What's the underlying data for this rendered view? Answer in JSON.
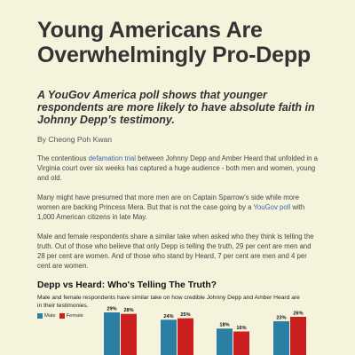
{
  "article": {
    "headline": "Young Americans Are Overwhelmingly Pro-Depp",
    "subheadline": "A YouGov America poll shows that younger respondents are more likely to have absolute faith in Johnny Depp’s testimony.",
    "byline": "By Cheong Poh Kwan",
    "p1": {
      "pre": "The contentious ",
      "link": "defamation trial",
      "post": " between Johnny Depp and Amber Heard that unfolded in a Virginia court over six weeks has captured a huge audience - both men and women, young and old."
    },
    "p2": {
      "pre": "Many might have presumed that more men are on Captain Sparrow’s side while more women are backing Princess Mera. But that is not the case going by a ",
      "link": "YouGov poll",
      "post": " with 1,000 American citizens in late May."
    },
    "p3": "Male and female respondents share a similar take when asked who they think is telling the truth. Out of those who believe that only Depp is telling the truth, 29 per cent are men and 28 per cent are women. And of those who stand by Heard, 7 per cent are men and 4 per cent are women."
  },
  "colors": {
    "background": "#f6f3dc",
    "male": "#2a7fa3",
    "female": "#cc1f1f",
    "link": "#3c67b0"
  },
  "chart_data": {
    "type": "bar",
    "title": "Depp vs Heard: Who's Telling The Truth?",
    "subtitle": "Male and female respondents have similar take on how credible Johnny Depp and Amber Heard are in their testimonies.",
    "legend": [
      "Male",
      "Female"
    ],
    "legend_position": "top-left",
    "categories": [
      "",
      "",
      "",
      ""
    ],
    "series": [
      {
        "name": "Male",
        "values": [
          29,
          24,
          18,
          23
        ],
        "labels": [
          "29%",
          "24%",
          "18%",
          "23%"
        ]
      },
      {
        "name": "Female",
        "values": [
          28,
          25,
          16,
          26
        ],
        "labels": [
          "28%",
          "25%",
          "16%",
          "26%"
        ]
      }
    ],
    "ylim": [
      0,
      40
    ],
    "grid": false
  }
}
